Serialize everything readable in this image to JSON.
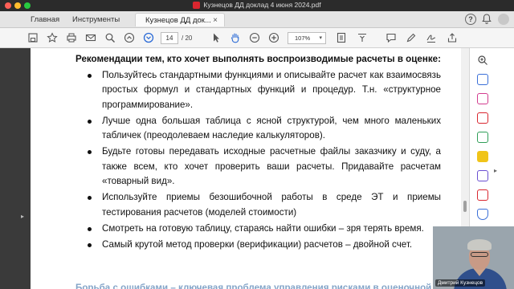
{
  "window": {
    "title": "Кузнецов ДД доклад 4 июня 2024.pdf"
  },
  "tabs": {
    "home": "Главная",
    "tools": "Инструменты",
    "document": "Кузнецов ДД док..."
  },
  "toolbar": {
    "page_current": "14",
    "page_total": "/ 20",
    "zoom": "107%"
  },
  "document": {
    "heading": "Рекомендации тем, кто хочет выполнять воспроизводимые расчеты в оценке:",
    "bullets": [
      "Пользуйтесь стандартными функциями и описывайте расчет как взаимосвязь простых формул и стандартных функций и процедур. Т.н. «структурное программирование».",
      "Лучше одна большая таблица с ясной структурой, чем много маленьких табличек (преодолеваем наследие калькуляторов).",
      "Будьте готовы передавать исходные расчетные файлы заказчику и суду, а также всем, кто хочет проверить ваши расчеты. Придавайте расчетам «товарный вид».",
      "Используйте приемы безошибочной работы в среде ЭТ и приемы тестирования расчетов (моделей стоимости)",
      "Смотреть на готовую таблицу, стараясь найти ошибки – зря терять время.",
      "Самый крутой метод проверки (верификации) расчетов – двойной счет."
    ],
    "partial_line": "Борьба с ошибками – ключевая проблема управления рисками в оценочной"
  },
  "webcam": {
    "name": "Дмитрий Кузнецов"
  },
  "icons": {
    "right_panel": [
      "zoom-search-icon",
      "add-pdf-icon",
      "edit-pdf-icon",
      "export-pdf-icon",
      "organize-pages-icon",
      "comment-icon",
      "combine-icon",
      "redact-icon",
      "protect-icon",
      "fill-sign-icon"
    ]
  },
  "colors": {
    "accent_red": "#d9262f",
    "text_link_blue": "#1e5a9c"
  }
}
